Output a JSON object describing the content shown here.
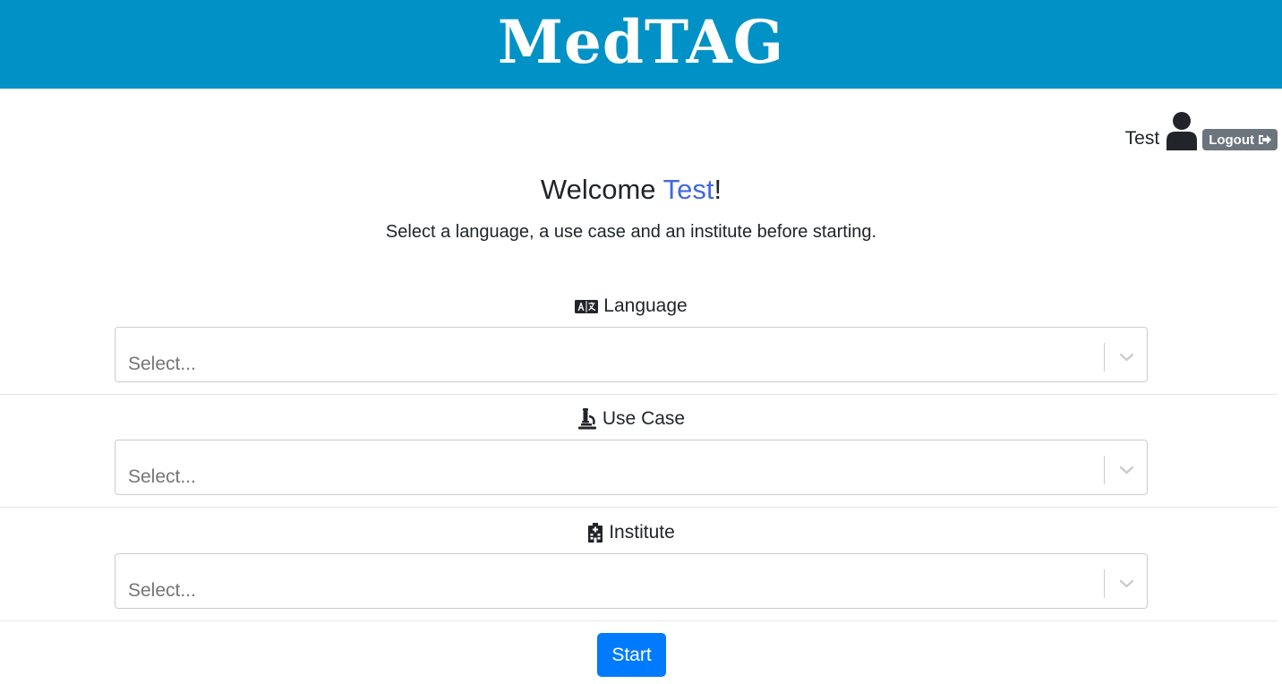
{
  "header": {
    "title": "MedTAG"
  },
  "user": {
    "name": "Test",
    "logout_label": "Logout",
    "icon": "user-icon"
  },
  "welcome": {
    "prefix": "Welcome ",
    "name": "Test",
    "suffix": "!",
    "subtitle": "Select a language, a use case and an institute before starting."
  },
  "fields": {
    "language": {
      "label": "Language",
      "icon": "language-icon",
      "placeholder": "Select..."
    },
    "use_case": {
      "label": "Use Case",
      "icon": "microscope-icon",
      "placeholder": "Select..."
    },
    "institute": {
      "label": "Institute",
      "icon": "hospital-icon",
      "placeholder": "Select..."
    }
  },
  "start_label": "Start",
  "colors": {
    "header_bg": "#0092c6",
    "accent_name": "#4169e1",
    "start_button": "#007bff",
    "logout_button": "#6c757d"
  }
}
